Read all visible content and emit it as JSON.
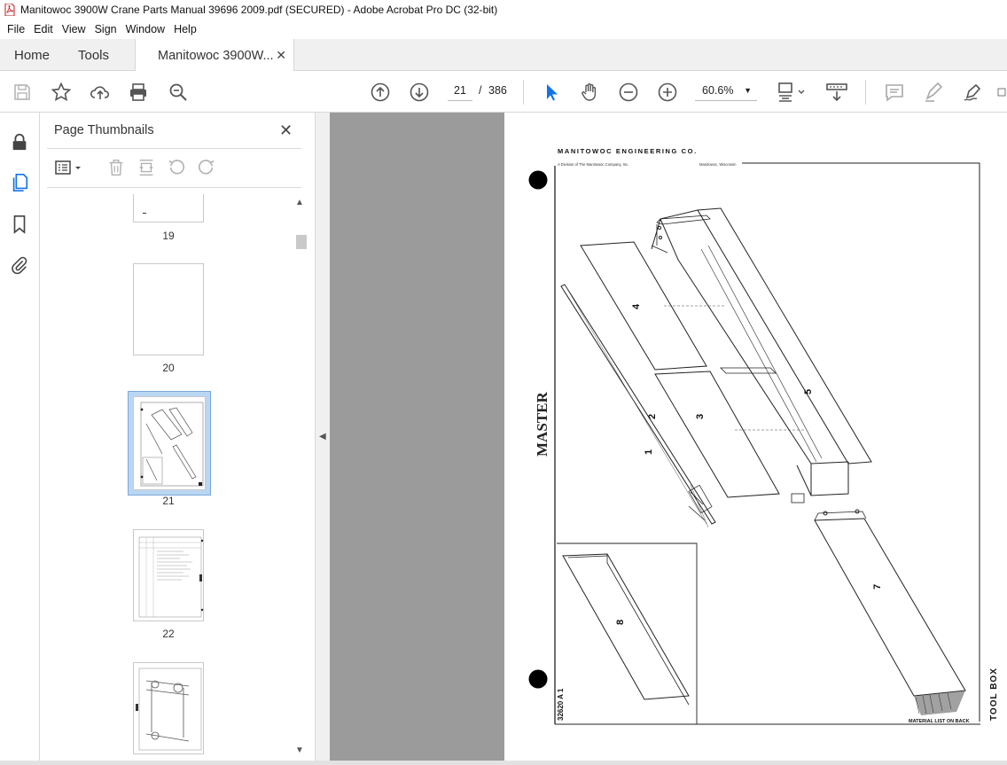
{
  "window": {
    "title": "Manitowoc 3900W Crane Parts Manual 39696 2009.pdf (SECURED) - Adobe Acrobat Pro DC (32-bit)"
  },
  "menu": [
    "File",
    "Edit",
    "View",
    "Sign",
    "Window",
    "Help"
  ],
  "tabs": {
    "home": "Home",
    "tools": "Tools",
    "document": "Manitowoc 3900W..."
  },
  "toolbar": {
    "current_page": "21",
    "page_separator": "/",
    "total_pages": "386",
    "zoom": "60.6%"
  },
  "thumbnails_panel": {
    "title": "Page Thumbnails",
    "pages": [
      {
        "number": "19"
      },
      {
        "number": "20"
      },
      {
        "number": "21",
        "selected": true
      },
      {
        "number": "22"
      },
      {
        "number": ""
      }
    ]
  },
  "document_page": {
    "company": "MANITOWOC ENGINEERING CO.",
    "division": "A Division of The Manitowoc Company, Inc.",
    "location": "Manitowoc, Wisconsin",
    "master_stamp": "MASTER",
    "part_labels": [
      "1",
      "2",
      "3",
      "4",
      "5",
      "7",
      "8"
    ],
    "drawing_number": "32620 A 1",
    "footer_note": "MATERIAL LIST ON BACK",
    "drawing_title": "TOOL BOX"
  },
  "colors": {
    "accent": "#1473e6",
    "toolbar_bg": "#ffffff",
    "tabbar_bg": "#f0f0f0",
    "viewer_bg": "#9b9b9b",
    "selection": "#b9d6f2"
  }
}
